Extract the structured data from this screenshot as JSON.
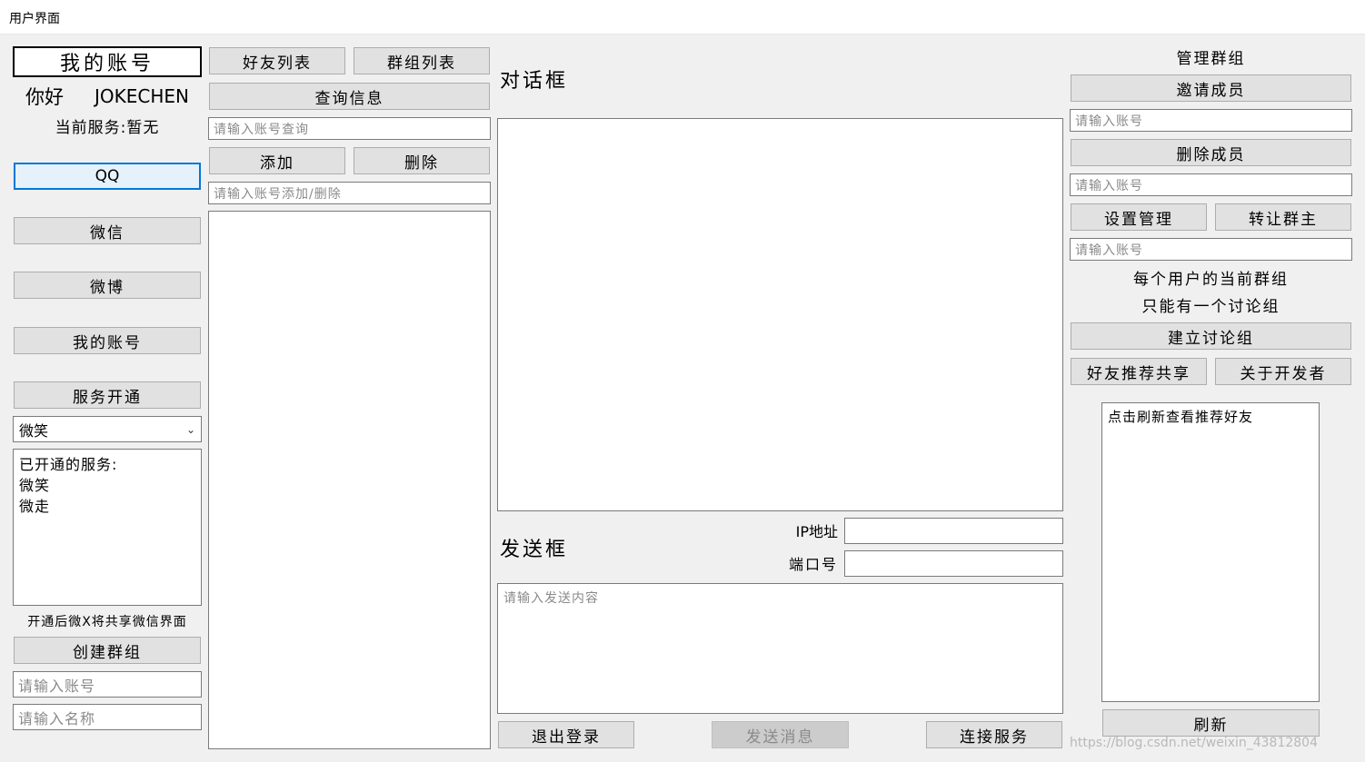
{
  "window": {
    "title": "用户界面"
  },
  "left": {
    "account_header": "我的账号",
    "greeting": "你好",
    "username": "JOKECHEN",
    "current_service": "当前服务:暂无",
    "buttons": {
      "qq": "QQ",
      "wechat": "微信",
      "weibo": "微博",
      "my_account": "我的账号",
      "service_open": "服务开通"
    },
    "service_select": "微笑",
    "opened_services": "已开通的服务:\n微笑\n微走",
    "share_note": "开通后微X将共享微信界面",
    "create_group_button": "创建群组",
    "account_placeholder": "请输入账号",
    "name_placeholder": "请输入名称"
  },
  "friends": {
    "friend_list_button": "好友列表",
    "group_list_button": "群组列表",
    "query_button": "查询信息",
    "query_placeholder": "请输入账号查询",
    "add_button": "添加",
    "delete_button": "删除",
    "add_delete_placeholder": "请输入账号添加/删除"
  },
  "chat": {
    "dialog_label": "对话框",
    "send_label": "发送框",
    "ip_label": "IP地址",
    "port_label": "端口号",
    "send_placeholder": "请输入发送内容",
    "logout_button": "退出登录",
    "send_button": "发送消息",
    "connect_button": "连接服务"
  },
  "manage": {
    "title": "管理群组",
    "invite_button": "邀请成员",
    "remove_button": "删除成员",
    "set_admin_button": "设置管理",
    "transfer_button": "转让群主",
    "account_placeholder": "请输入账号",
    "note_line1": "每个用户的当前群组",
    "note_line2": "只能有一个讨论组",
    "create_discussion_button": "建立讨论组",
    "share_button": "好友推荐共享",
    "about_button": "关于开发者",
    "recommend_text": "点击刷新查看推荐好友",
    "refresh_button": "刷新"
  },
  "watermark": "https://blog.csdn.net/weixin_43812804",
  "colors": {
    "background": "#f0f0f0",
    "button": "#e1e1e1",
    "focus": "#0078d7"
  }
}
